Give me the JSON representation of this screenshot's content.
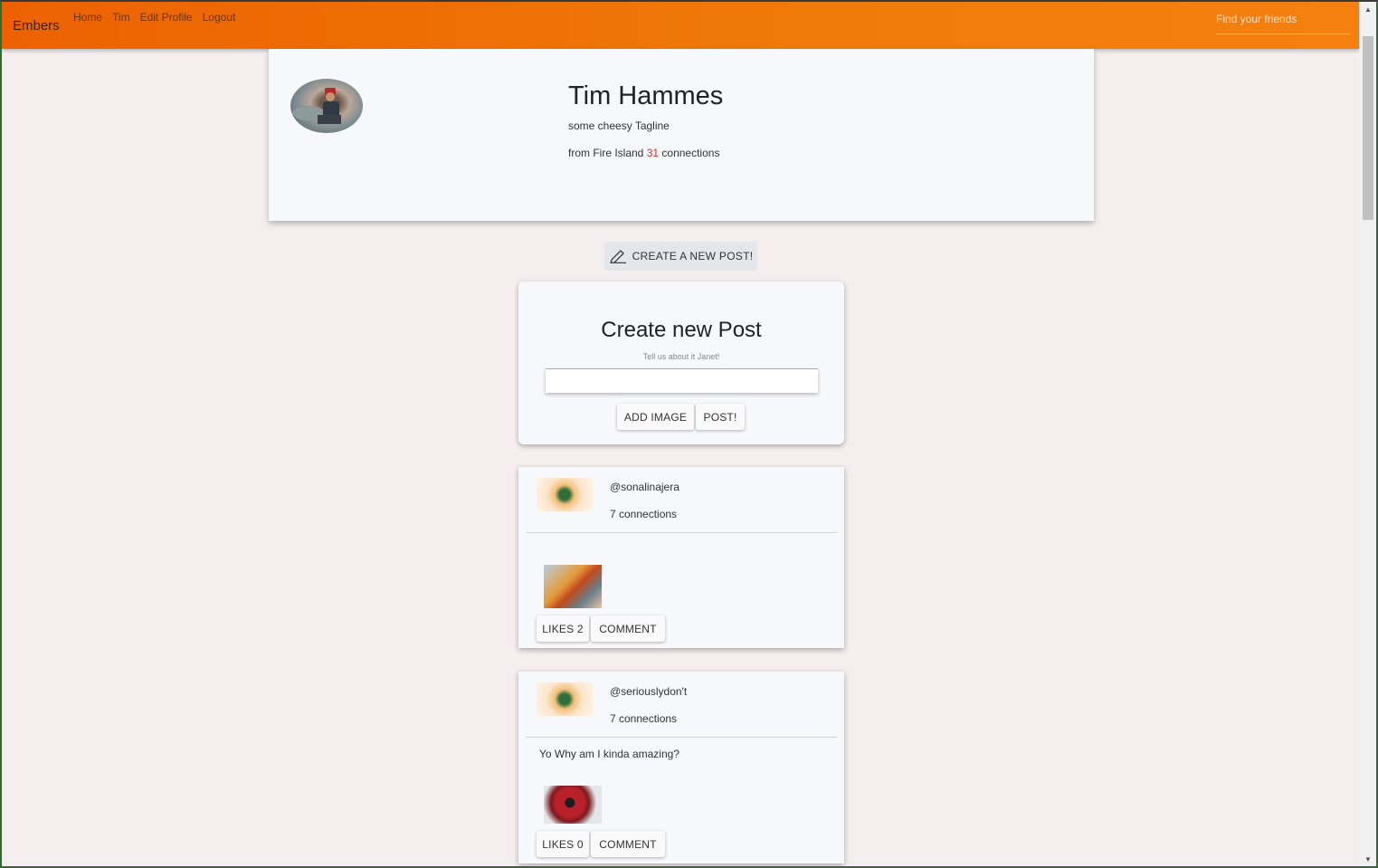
{
  "navbar": {
    "brand": "Embers",
    "links": [
      "Home",
      "Tim",
      "Edit Profile",
      "Logout"
    ],
    "search_placeholder": "Find your friends"
  },
  "profile": {
    "name": "Tim Hammes",
    "tagline": "some cheesy Tagline",
    "location_prefix": "from Fire Island",
    "connections": "31",
    "connections_suffix": "connections"
  },
  "create_button": {
    "label": "CREATE A NEW POST!",
    "icon": "pencil-icon"
  },
  "new_post": {
    "title": "Create new Post",
    "hint": "Tell us about it Janet!",
    "input_value": "",
    "add_image_label": "ADD IMAGE",
    "post_label": "POST!"
  },
  "posts": [
    {
      "handle": "@sonalinajera",
      "connections": "7 connections",
      "body": "",
      "image": "burning-house-girl-meme",
      "likes_label": "LIKES 2",
      "comment_label": "COMMENT"
    },
    {
      "handle": "@seriouslydon't",
      "connections": "7 connections",
      "body": "Yo Why am I kinda amazing?",
      "image": "deadpool-thumbs-up",
      "likes_label": "LIKES 0",
      "comment_label": "COMMENT"
    }
  ],
  "colors": {
    "navbar": "#ec6200",
    "accent_count": "#d2342c",
    "input_underline": "#e3b100"
  }
}
